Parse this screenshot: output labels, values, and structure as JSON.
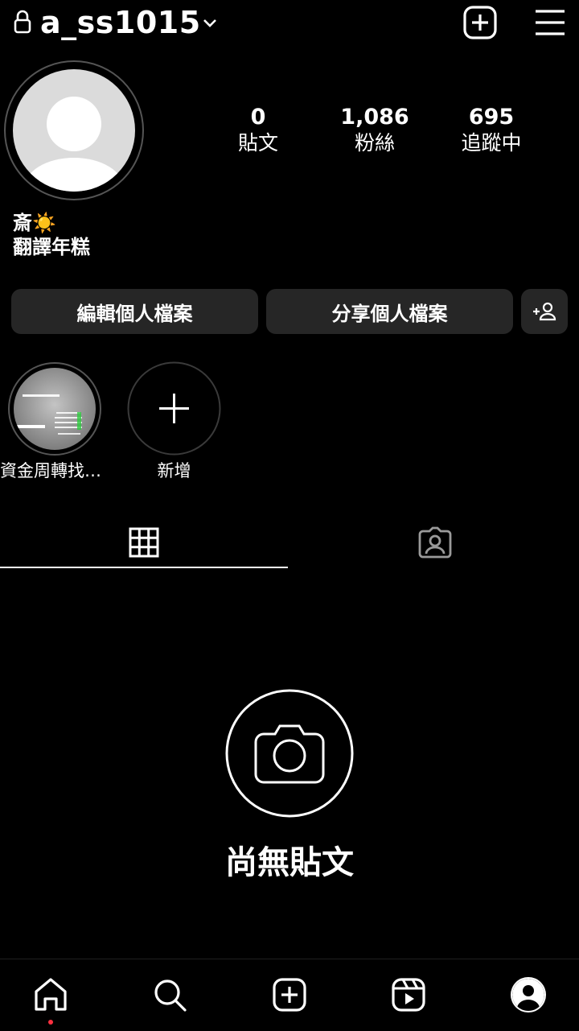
{
  "header": {
    "username": "a_ss1015",
    "icons": {
      "lock": "lock-icon",
      "dropdown": "chevron-down-icon",
      "create": "plus-square-icon",
      "menu": "hamburger-menu-icon"
    }
  },
  "profile": {
    "stats": {
      "posts": {
        "value": "0",
        "label": "貼文"
      },
      "followers": {
        "value": "1,086",
        "label": "粉絲"
      },
      "following": {
        "value": "695",
        "label": "追蹤中"
      }
    },
    "bio_name": "斎☀️",
    "bio_text": "翻譯年糕"
  },
  "buttons": {
    "edit": "編輯個人檔案",
    "share": "分享個人檔案",
    "suggest_icon": "add-person-icon"
  },
  "highlights": [
    {
      "label": "資金周轉找…"
    },
    {
      "label": "新增"
    }
  ],
  "tabs": [
    {
      "name": "posts-grid",
      "icon": "grid-icon",
      "active": true
    },
    {
      "name": "tagged",
      "icon": "tagged-person-icon",
      "active": false
    }
  ],
  "empty_state": {
    "text": "尚無貼文",
    "icon": "camera-icon"
  },
  "bottom_nav": {
    "items": [
      "home-icon",
      "search-icon",
      "create-icon",
      "reels-icon",
      "profile-icon"
    ],
    "notification_color": "#ff3040"
  },
  "colors": {
    "background": "#000000",
    "button": "#262626",
    "text": "#ffffff",
    "ring": "#555555"
  }
}
